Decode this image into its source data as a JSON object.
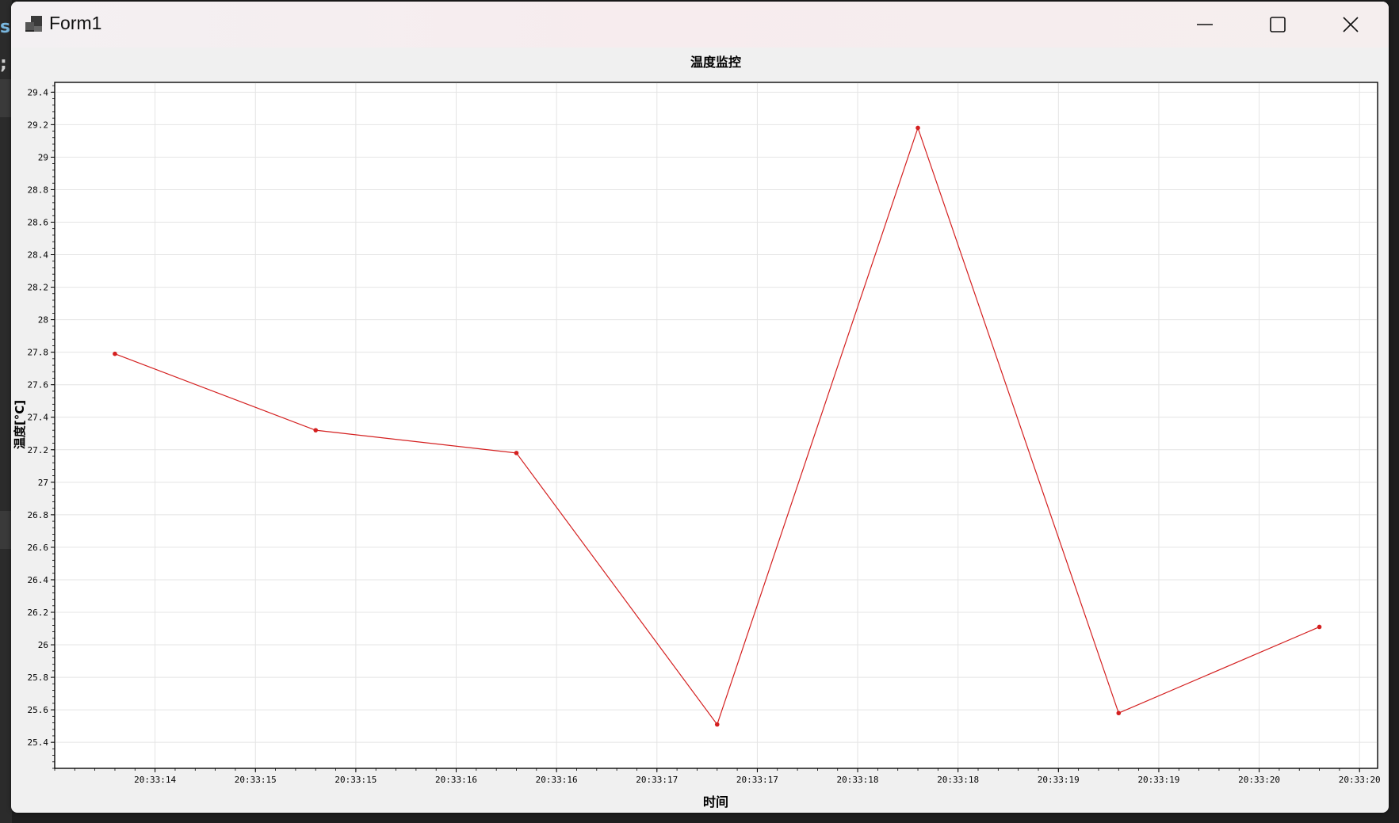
{
  "window": {
    "title": "Form1",
    "controls": [
      "minimize-icon",
      "maximize-icon",
      "close-icon"
    ]
  },
  "chart_data": {
    "type": "line",
    "title": "温度监控",
    "xlabel": "时间",
    "ylabel": "温度[°C]",
    "x": [
      "20:33:13.6",
      "20:33:14.6",
      "20:33:15.6",
      "20:33:16.6",
      "20:33:17.6",
      "20:33:18.6",
      "20:33:19.6"
    ],
    "xlim": [
      "20:33:13.30",
      "20:33:19.89"
    ],
    "xticks": [
      {
        "t": "20:33:13.8",
        "label": "20:33:14"
      },
      {
        "t": "20:33:14.3",
        "label": "20:33:15"
      },
      {
        "t": "20:33:14.8",
        "label": "20:33:15"
      },
      {
        "t": "20:33:15.3",
        "label": "20:33:16"
      },
      {
        "t": "20:33:15.8",
        "label": "20:33:16"
      },
      {
        "t": "20:33:16.3",
        "label": "20:33:17"
      },
      {
        "t": "20:33:16.8",
        "label": "20:33:17"
      },
      {
        "t": "20:33:17.3",
        "label": "20:33:18"
      },
      {
        "t": "20:33:17.8",
        "label": "20:33:18"
      },
      {
        "t": "20:33:18.3",
        "label": "20:33:19"
      },
      {
        "t": "20:33:18.8",
        "label": "20:33:19"
      },
      {
        "t": "20:33:19.3",
        "label": "20:33:20"
      },
      {
        "t": "20:33:19.8",
        "label": "20:33:20"
      }
    ],
    "ylim": [
      25.24,
      29.46
    ],
    "yticks": [
      25.4,
      25.6,
      25.8,
      26,
      26.2,
      26.4,
      26.6,
      26.8,
      27,
      27.2,
      27.4,
      27.6,
      27.8,
      28,
      28.2,
      28.4,
      28.6,
      28.8,
      29,
      29.2,
      29.4
    ],
    "ytick_labels": [
      "25.4",
      "25.6",
      "25.8",
      "26",
      "26.2",
      "26.4",
      "26.6",
      "26.8",
      "27",
      "27.2",
      "27.4",
      "27.6",
      "27.8",
      "28",
      "28.2",
      "28.4",
      "28.6",
      "28.8",
      "29",
      "29.2",
      "29.4"
    ],
    "series": [
      {
        "values": [
          27.79,
          27.32,
          27.18,
          25.51,
          29.18,
          25.58,
          26.11
        ],
        "color": "#d42020"
      }
    ],
    "grid": true,
    "legend": "none"
  }
}
